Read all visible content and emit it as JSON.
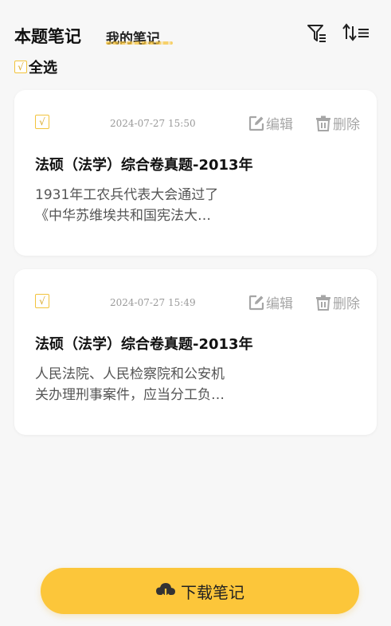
{
  "header": {
    "title": "本题笔记",
    "tab_my_notes": "我的笔记"
  },
  "select_all": {
    "checkmark": "√",
    "label": "全选"
  },
  "notes": [
    {
      "checkmark": "√",
      "time": "2024-07-27 15:50",
      "edit_label": "编辑",
      "delete_label": "删除",
      "title": "法硕（法学）综合卷真题-2013年",
      "excerpt_line1": "1931年工农兵代表大会通过了",
      "excerpt_line2": "《中华苏维埃共和国宪法大…"
    },
    {
      "checkmark": "√",
      "time": "2024-07-27 15:49",
      "edit_label": "编辑",
      "delete_label": "删除",
      "title": "法硕（法学）综合卷真题-2013年",
      "excerpt_line1": "人民法院、人民检察院和公安机",
      "excerpt_line2": "关办理刑事案件，应当分工负…"
    }
  ],
  "download_button": {
    "label": "下载笔记"
  },
  "colors": {
    "accent": "#fcc63a",
    "checkbox_border": "#f2c33c",
    "muted": "#a6a6a6"
  },
  "icons": [
    "filter-icon",
    "sort-icon",
    "edit-icon",
    "trash-icon",
    "cloud-download-icon"
  ]
}
